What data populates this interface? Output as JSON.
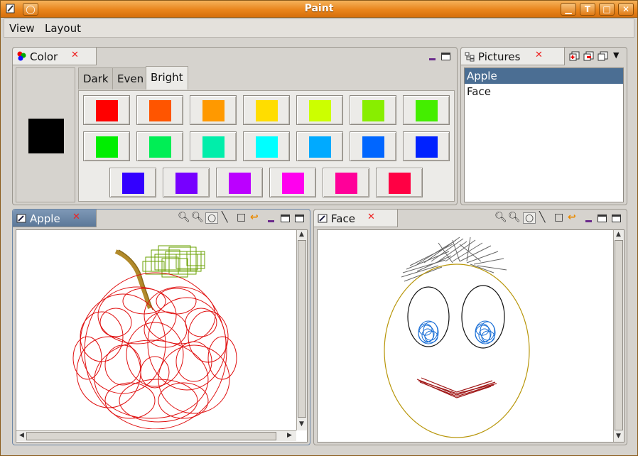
{
  "window": {
    "title": "Paint"
  },
  "menu": {
    "items": [
      "View",
      "Layout"
    ]
  },
  "color_panel": {
    "tab_label": "Color",
    "current_color": "#000000",
    "subtabs": [
      "Dark",
      "Even",
      "Bright"
    ],
    "active_subtab": "Bright",
    "rows": [
      [
        "#ff0000",
        "#ff5500",
        "#ff9900",
        "#ffdd00",
        "#ccff00",
        "#88ee00",
        "#44ee00"
      ],
      [
        "#00ee00",
        "#00ee55",
        "#00eeaa",
        "#00ffff",
        "#00aaff",
        "#0066ff",
        "#0022ff"
      ],
      [
        "#3300ff",
        "#7700ff",
        "#bb00ff",
        "#ff00ee",
        "#ff0099",
        "#ff0044"
      ]
    ]
  },
  "pictures_panel": {
    "tab_label": "Pictures",
    "items": [
      "Apple",
      "Face"
    ],
    "selected": "Apple"
  },
  "apple_panel": {
    "tab_label": "Apple"
  },
  "face_panel": {
    "tab_label": "Face"
  },
  "colors": {
    "title_orange": "#e9851c",
    "selection_blue": "#4b6e93",
    "active_tab_blue": "#5c7898"
  }
}
